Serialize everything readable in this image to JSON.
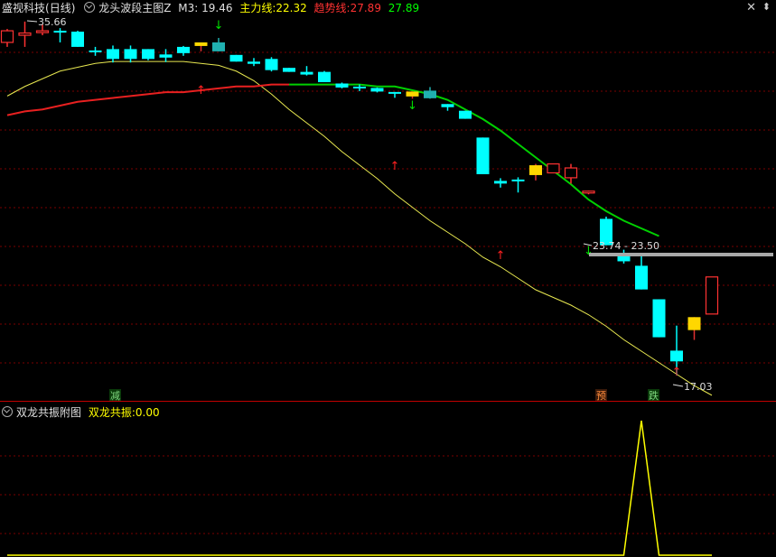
{
  "header": {
    "stock_name": "盛视科技",
    "period": "(日线)",
    "indicator_name": "龙头波段主图Z",
    "m3": "M3: 19.46",
    "main_label": "主力线:",
    "main_value": "22.32",
    "trend_label": "趋势线:",
    "trend_value1": "27.89",
    "trend_value2": "27.89"
  },
  "sub_header": {
    "name": "双龙共振附图",
    "label": "双龙共振:",
    "value": "0.00"
  },
  "colors": {
    "up": "#ff3232",
    "down": "#00ffff",
    "signal_candle": "#ffd700",
    "ma_yellow": "#e8e850",
    "ma_red": "#e82020",
    "ma_green": "#00d000",
    "grid": "#7a0000",
    "resist_band": "#a8a8a8"
  },
  "labels": {
    "high": "35.66",
    "range": "23.74 - 23.50",
    "low": "17.03",
    "mark1": "减",
    "mark2": "预",
    "mark3": "跌"
  },
  "chart_data": {
    "type": "candlestick",
    "candles": [
      [
        31.0,
        33.6,
        30.0,
        34.0,
        "up"
      ],
      [
        32.6,
        33.1,
        30.0,
        35.66,
        "up"
      ],
      [
        33.5,
        33.6,
        32.6,
        35.0,
        "up"
      ],
      [
        33.4,
        33.6,
        31.0,
        34.2,
        "down"
      ],
      [
        33.4,
        30.0,
        30.0,
        33.6,
        "down"
      ],
      [
        29.2,
        28.8,
        28.0,
        30.0,
        "down"
      ],
      [
        29.5,
        27.3,
        26.5,
        30.3,
        "down"
      ],
      [
        29.5,
        27.3,
        26.5,
        30.3,
        "down"
      ],
      [
        29.5,
        27.3,
        27.0,
        29.5,
        "down"
      ],
      [
        28.3,
        27.6,
        26.6,
        29.5,
        "down"
      ],
      [
        30.0,
        28.6,
        28.0,
        30.2,
        "down"
      ],
      [
        30.2,
        31.0,
        29.0,
        31.0,
        "signal"
      ],
      [
        31.0,
        29.0,
        29.0,
        32.0,
        "signal_down"
      ],
      [
        28.2,
        26.7,
        26.7,
        28.2,
        "down"
      ],
      [
        26.7,
        26.2,
        25.7,
        27.5,
        "down"
      ],
      [
        27.3,
        24.8,
        24.5,
        27.7,
        "down"
      ],
      [
        25.3,
        24.4,
        24.4,
        25.3,
        "down"
      ],
      [
        24.4,
        23.8,
        23.6,
        25.7,
        "down"
      ],
      [
        24.4,
        22.1,
        22.1,
        24.6,
        "down"
      ],
      [
        21.8,
        20.9,
        20.7,
        22.0,
        "down"
      ],
      [
        21.1,
        20.8,
        20.1,
        21.6,
        "down"
      ],
      [
        20.8,
        20.0,
        19.8,
        20.9,
        "down"
      ],
      [
        19.9,
        19.5,
        18.6,
        19.9,
        "down"
      ],
      [
        18.9,
        20.0,
        18.4,
        20.0,
        "signal"
      ],
      [
        20.2,
        18.5,
        18.4,
        21.0,
        "signal_down"
      ],
      [
        17.2,
        16.5,
        15.7,
        17.2,
        "down"
      ],
      [
        15.7,
        13.9,
        13.9,
        15.7,
        "down"
      ],
      [
        9.7,
        1.5,
        1.5,
        9.7,
        "down"
      ],
      [
        0.0,
        -0.6,
        -1.5,
        0.6,
        "down"
      ],
      [
        0.3,
        0.0,
        -2.6,
        0.8,
        "down"
      ],
      [
        1.3,
        3.5,
        0.1,
        3.8,
        "signal"
      ],
      [
        1.8,
        3.8,
        1.8,
        3.8,
        "up"
      ],
      [
        0.7,
        2.9,
        -0.6,
        3.8,
        "up"
      ],
      [
        -2.6,
        -2.3,
        -3.0,
        -2.2,
        "up"
      ],
      [
        -8.5,
        -14.4,
        -14.4,
        -8.0,
        "down"
      ],
      [
        -16.3,
        -18.0,
        -18.5,
        -15.4,
        "down"
      ],
      [
        -19.0,
        -24.3,
        -24.3,
        -16.5,
        "down"
      ],
      [
        -26.5,
        -35.0,
        -35.0,
        -26.5,
        "down"
      ],
      [
        -38.0,
        -40.4,
        -43.5,
        -32.4,
        "down"
      ],
      [
        -33.4,
        -30.5,
        -35.6,
        -30.5,
        "signal"
      ],
      [
        -29.8,
        -21.5,
        -29.8,
        -21.5,
        "up"
      ]
    ],
    "mini_series": [
      0,
      0,
      0,
      0,
      0,
      0,
      0,
      0,
      0,
      0,
      0,
      0,
      0,
      0,
      0,
      0,
      0,
      0,
      0,
      0,
      0,
      0,
      0,
      0,
      0,
      0,
      0,
      0,
      0,
      0,
      0,
      0,
      0,
      0,
      0,
      0,
      1,
      0,
      0,
      0,
      0
    ],
    "up_arrows": [
      11,
      22,
      28,
      38
    ],
    "down_arrows": [
      12,
      23,
      33
    ]
  }
}
